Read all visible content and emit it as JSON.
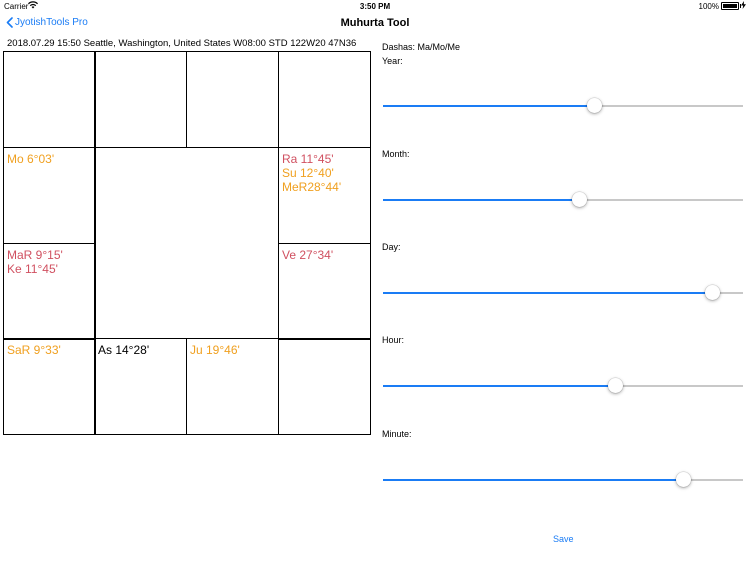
{
  "status": {
    "carrier": "Carrier",
    "time": "3:50 PM",
    "battery": "100%"
  },
  "nav": {
    "back_label": "JyotishTools Pro",
    "title": "Muhurta Tool"
  },
  "info_line": "2018.07.29 15:50 Seattle, Washington, United States W08:00 STD 122W20 47N36",
  "chart": {
    "mo": "Mo  6°03'",
    "ra": "Ra 11°45'",
    "su": "Su 12°40'",
    "mer": "MeR28°44'",
    "mar": "MaR 9°15'",
    "ke": "Ke 11°45'",
    "ve": "Ve 27°34'",
    "sar": "SaR 9°33'",
    "as": "As 14°28'",
    "ju": "Ju 19°46'"
  },
  "colors": {
    "accent": "#1a7cf5",
    "orange": "#f0a020",
    "red": "#d05060"
  },
  "panel": {
    "dashas": "Dashas: Ma/Mo/Me",
    "sliders": [
      {
        "label": "Year:",
        "value": 0.587
      },
      {
        "label": "Month:",
        "value": 0.545
      },
      {
        "label": "Day:",
        "value": 0.915
      },
      {
        "label": "Hour:",
        "value": 0.645
      },
      {
        "label": "Minute:",
        "value": 0.835
      }
    ],
    "save_label": "Save"
  }
}
